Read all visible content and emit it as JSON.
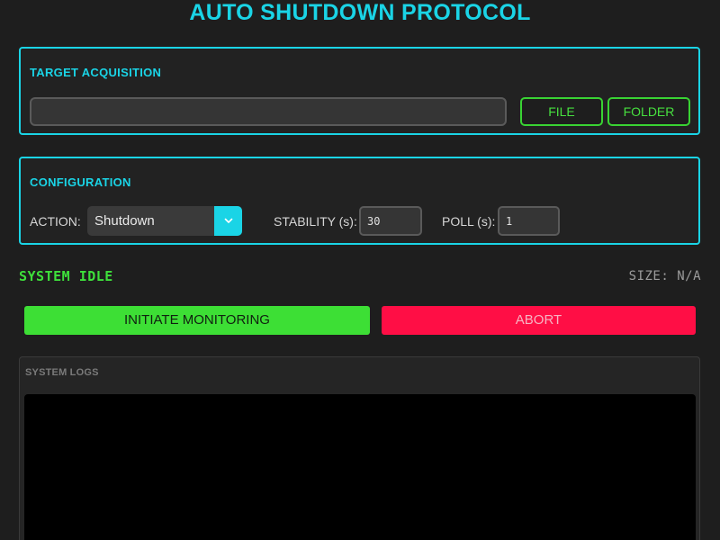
{
  "app": {
    "title": "AUTO SHUTDOWN PROTOCOL"
  },
  "target": {
    "section_title": "TARGET ACQUISITION",
    "path_value": "",
    "path_placeholder": "",
    "file_label": "FILE",
    "folder_label": "FOLDER"
  },
  "config": {
    "section_title": "CONFIGURATION",
    "action_label": "ACTION:",
    "action_value": "Shutdown",
    "action_arrow_icon": "chevron-down-icon",
    "stability_label": "STABILITY (s):",
    "stability_value": "30",
    "poll_label": "POLL (s):",
    "poll_value": "1"
  },
  "status": {
    "text": "SYSTEM IDLE",
    "size_text": "SIZE: N/A"
  },
  "controls": {
    "initiate_label": "INITIATE MONITORING",
    "abort_label": "ABORT"
  },
  "logs": {
    "title": "SYSTEM LOGS",
    "content": ""
  },
  "colors": {
    "accent_cyan": "#1ad4e6",
    "accent_green": "#3ddf35",
    "accent_red": "#ff0e45",
    "background": "#1e1e1e"
  }
}
